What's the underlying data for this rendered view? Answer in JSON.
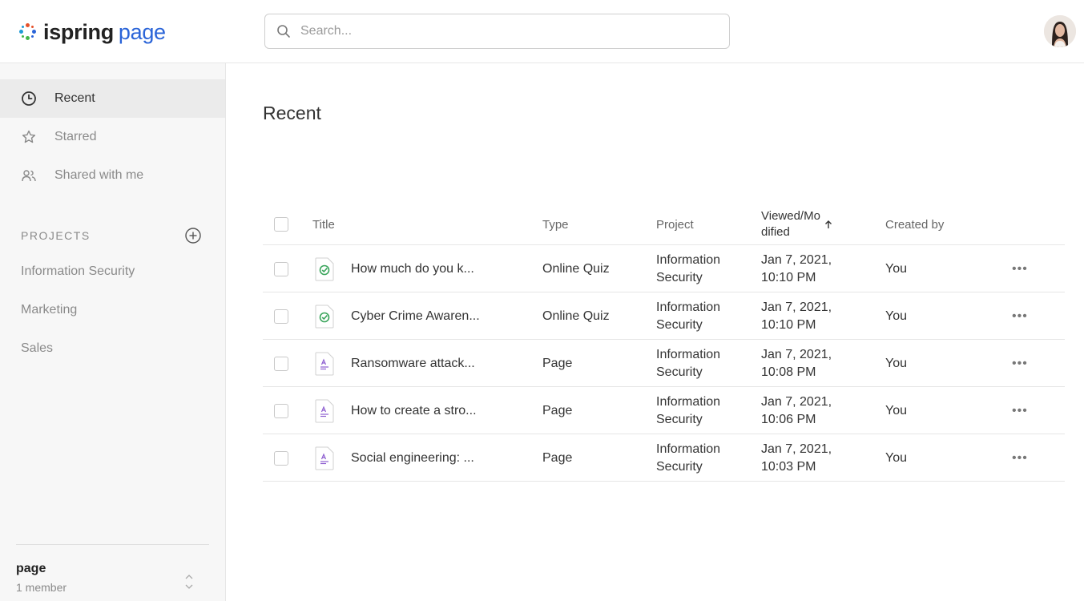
{
  "header": {
    "logo_word1": "ispring",
    "logo_word2": "page",
    "search_placeholder": "Search...",
    "logo_colors": [
      "#1e9ad6",
      "#e5512a",
      "#2a64d8",
      "#43b649"
    ]
  },
  "sidebar": {
    "nav": [
      {
        "label": "Recent",
        "icon": "clock-icon",
        "active": true
      },
      {
        "label": "Starred",
        "icon": "star-icon",
        "active": false
      },
      {
        "label": "Shared with me",
        "icon": "people-icon",
        "active": false
      }
    ],
    "projects_heading": "PROJECTS",
    "projects": [
      "Information Security",
      "Marketing",
      "Sales"
    ],
    "workspace": {
      "name": "page",
      "members": "1 member"
    }
  },
  "main": {
    "title": "Recent",
    "columns": {
      "title": "Title",
      "type": "Type",
      "project": "Project",
      "modified": "Viewed/Mo\ndified",
      "created_by": "Created by"
    },
    "rows": [
      {
        "icon": "quiz-icon",
        "title": "How much do you k...",
        "type": "Online Quiz",
        "project": "Information\nSecurity",
        "modified": "Jan 7, 2021,\n10:10 PM",
        "created_by": "You",
        "more": "•••"
      },
      {
        "icon": "quiz-icon",
        "title": "Cyber Crime Awaren...",
        "type": "Online Quiz",
        "project": "Information\nSecurity",
        "modified": "Jan 7, 2021,\n10:10 PM",
        "created_by": "You",
        "more": "•••"
      },
      {
        "icon": "page-icon",
        "title": "Ransomware attack...",
        "type": "Page",
        "project": "Information\nSecurity",
        "modified": "Jan 7, 2021,\n10:08 PM",
        "created_by": "You",
        "more": "•••"
      },
      {
        "icon": "page-icon",
        "title": "How to create a stro...",
        "type": "Page",
        "project": "Information\nSecurity",
        "modified": "Jan 7, 2021,\n10:06 PM",
        "created_by": "You",
        "more": "•••"
      },
      {
        "icon": "page-icon",
        "title": "Social engineering: ...",
        "type": "Page",
        "project": "Information\nSecurity",
        "modified": "Jan 7, 2021,\n10:03 PM",
        "created_by": "You",
        "more": "•••"
      }
    ]
  },
  "colors": {
    "brand_blue": "#2a64d8",
    "quiz_green": "#3ba55c",
    "page_purple": "#8e5fd0"
  }
}
